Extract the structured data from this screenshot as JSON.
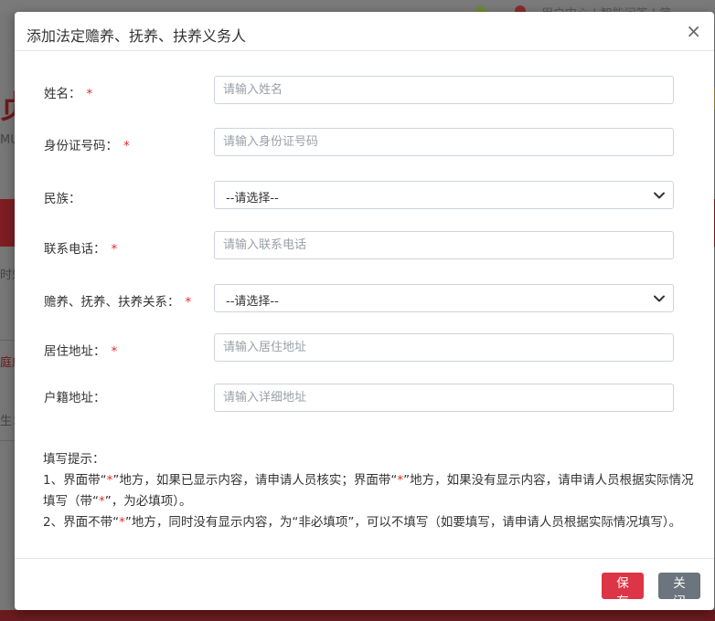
{
  "background": {
    "top_text": "用户中心 | 智能问答 | 简",
    "left_fragments": [
      "MU",
      "时效",
      "庭成",
      "生："
    ]
  },
  "modal": {
    "title": "添加法定赡养、抚养、扶养义务人",
    "close_symbol": "×",
    "required_mark": "*",
    "fields": {
      "name": {
        "label": "姓名：",
        "placeholder": "请输入姓名",
        "required": true
      },
      "id_number": {
        "label": "身份证号码：",
        "placeholder": "请输入身份证号码",
        "required": true
      },
      "ethnicity": {
        "label": "民族：",
        "selected": "--请选择--",
        "required": false
      },
      "phone": {
        "label": "联系电话：",
        "placeholder": "请输入联系电话",
        "required": true
      },
      "relation": {
        "label": "赡养、抚养、扶养关系：",
        "selected": "--请选择--",
        "required": true
      },
      "residence": {
        "label": "居住地址：",
        "placeholder": "请输入居住地址",
        "required": true
      },
      "household": {
        "label": "户籍地址：",
        "placeholder": "请输入详细地址",
        "required": false
      }
    },
    "tips": {
      "heading": "填写提示：",
      "line1_a": "1、界面带“",
      "star": "*",
      "line1_b": "”地方，如果已显示内容，请申请人员核实；界面带“",
      "line1_c": "”地方，如果没有显示内容，请申请人员根据实际情况填写（带“",
      "line1_d": "”，为必填项）。",
      "line2_a": "2、界面不带“",
      "line2_b": "”地方，同时没有显示内容，为“非必填项”，可以不填写（如要填写，请申请人员根据实际情况填写）。"
    },
    "buttons": {
      "save": "保存",
      "close": "关闭"
    }
  },
  "colors": {
    "required": "#e02b2b",
    "save_button": "#dc3545",
    "close_button": "#6c757d"
  }
}
